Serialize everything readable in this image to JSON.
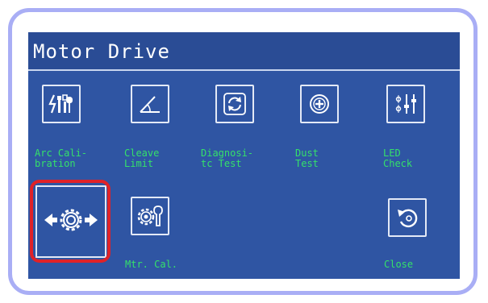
{
  "screen": {
    "title": "Motor Drive"
  },
  "menu": {
    "arc_calibration": {
      "icon": "arc-calibration-icon",
      "label": "Arc Cali-\nbration"
    },
    "cleave_limit": {
      "icon": "cleave-angle-icon",
      "label": "Cleave\nLimit"
    },
    "diagnostic_test": {
      "icon": "diagnostic-refresh-icon",
      "label": "Diagnosi-\ntc Test"
    },
    "dust_test": {
      "icon": "dust-plus-icon",
      "label": "Dust\nTest"
    },
    "led_check": {
      "icon": "led-sliders-icon",
      "label": "LED\nCheck"
    },
    "motor_drive": {
      "icon": "motor-gear-arrows-icon"
    },
    "motor_calibration": {
      "icon": "gear-wrench-icon",
      "label": "Mtr. Cal."
    },
    "close": {
      "icon": "close-return-icon",
      "label": "Close"
    }
  },
  "colors": {
    "screen_bg": "#2f55a3",
    "label_green": "#35e06a",
    "selection_red": "#e02228",
    "frame_lavender": "#a9aef5"
  }
}
